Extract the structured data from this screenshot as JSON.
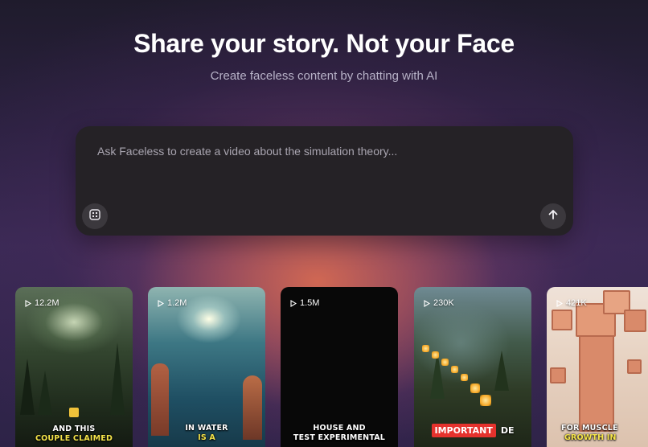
{
  "hero": {
    "title": "Share your story. Not your Face",
    "subtitle": "Create faceless content by chatting with AI"
  },
  "prompt": {
    "placeholder": "Ask Faceless to create a video about the simulation theory...",
    "attach_icon": "grid-icon",
    "send_icon": "arrow-up-icon"
  },
  "cards": [
    {
      "views": "12.2M",
      "caption_line1": "AND THIS",
      "caption_line2": "COUPLE CLAIMED"
    },
    {
      "views": "1.2M",
      "caption_line1": "IN WATER",
      "caption_line2": "IS A"
    },
    {
      "views": "1.5M",
      "caption_line1": "HOUSE AND",
      "caption_line2": "TEST EXPERIMENTAL"
    },
    {
      "views": "230K",
      "caption_line1": "IMPORTANT",
      "caption_line2": "DE"
    },
    {
      "views": "421K",
      "caption_line1": "FOR MUSCLE",
      "caption_line2": "GROWTH IN"
    }
  ],
  "colors": {
    "accent_yellow": "#f5e44a",
    "highlight_red": "#e5322d"
  }
}
